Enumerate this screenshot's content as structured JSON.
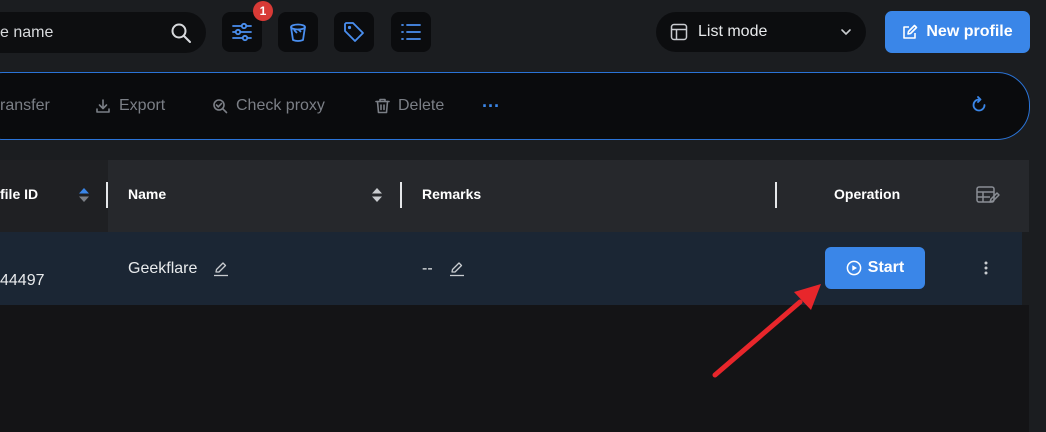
{
  "search": {
    "value": "e name"
  },
  "filter": {
    "badge_count": "1"
  },
  "view_mode": {
    "label": "List mode"
  },
  "header": {
    "new_profile_label": "New profile"
  },
  "toolbar": {
    "transfer_label": "ransfer",
    "export_label": "Export",
    "check_proxy_label": "Check proxy",
    "delete_label": "Delete",
    "more_label": "···"
  },
  "table": {
    "columns": [
      "file ID",
      "Name",
      "Remarks",
      "Operation"
    ],
    "rows": [
      {
        "profile_id": "44497",
        "name": "Geekflare",
        "remarks": "--",
        "action_label": "Start"
      }
    ]
  },
  "colors": {
    "accent": "#3a86e8",
    "annotation_arrow": "#e8262b",
    "badge": "#d83a36"
  }
}
